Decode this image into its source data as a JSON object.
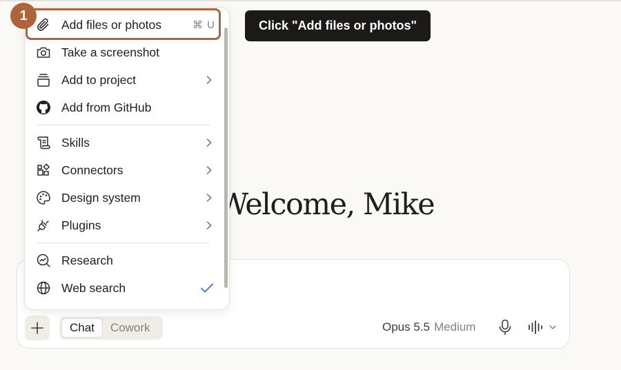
{
  "welcome": {
    "greeting": "Welcome, Mike"
  },
  "composer": {
    "modes": [
      "Chat",
      "Cowork"
    ],
    "active_mode": "Chat",
    "model": "Opus 5.5",
    "effort": "Medium"
  },
  "menu": {
    "items": [
      {
        "label": "Add files or photos",
        "icon": "paperclip-icon",
        "shortcut": "⌘ U"
      },
      {
        "label": "Take a screenshot",
        "icon": "camera-icon"
      },
      {
        "label": "Add to project",
        "icon": "project-stack-icon",
        "submenu": true
      },
      {
        "label": "Add from GitHub",
        "icon": "github-icon"
      },
      {
        "label": "Skills",
        "icon": "scroll-icon",
        "submenu": true
      },
      {
        "label": "Connectors",
        "icon": "connectors-icon",
        "submenu": true
      },
      {
        "label": "Design system",
        "icon": "palette-icon",
        "submenu": true
      },
      {
        "label": "Plugins",
        "icon": "plug-icon",
        "submenu": true
      },
      {
        "label": "Research",
        "icon": "research-icon"
      },
      {
        "label": "Web search",
        "icon": "globe-icon",
        "checked": true
      }
    ]
  },
  "annotation": {
    "step_number": "1",
    "instruction": "Click \"Add files or photos\"",
    "accent_color": "#b0623a"
  }
}
